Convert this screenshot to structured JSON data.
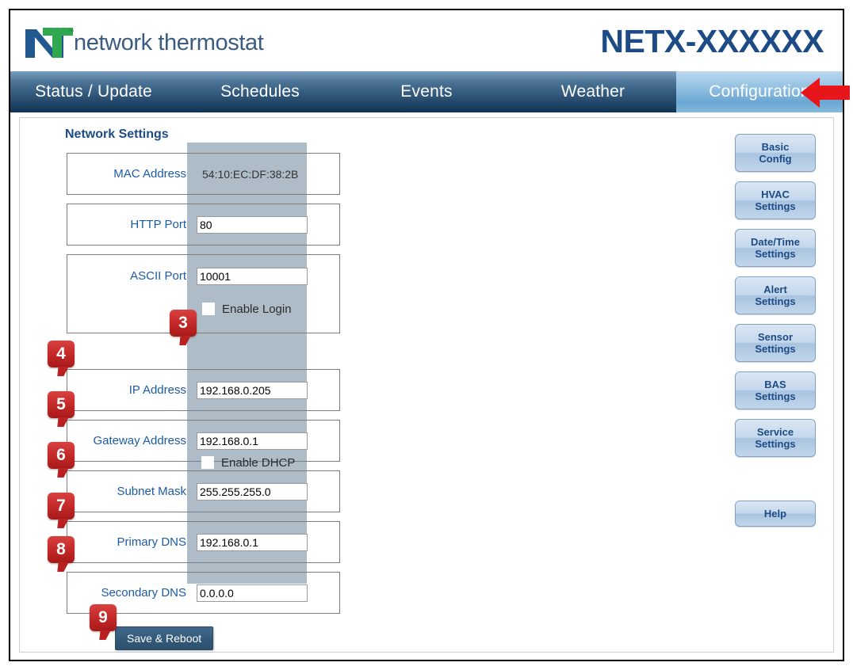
{
  "header": {
    "logo_text": "network thermostat",
    "logo_tm": "™",
    "logo_n": "N",
    "logo_t": "T",
    "device_title": "NETX-XXXXXX",
    "brand_blue": "#1c4b86",
    "brand_green": "#2fa84f"
  },
  "nav": {
    "tabs": [
      {
        "label": "Status / Update",
        "active": false
      },
      {
        "label": "Schedules",
        "active": false
      },
      {
        "label": "Events",
        "active": false
      },
      {
        "label": "Weather",
        "active": false
      },
      {
        "label": "Configuration",
        "active": true
      }
    ]
  },
  "main": {
    "section_title": "Network Settings",
    "rows": [
      {
        "label": "MAC Address",
        "value": "54:10:EC:DF:38:2B",
        "type": "static"
      },
      {
        "label": "HTTP Port",
        "value": "80",
        "type": "input"
      },
      {
        "label": "ASCII Port",
        "value": "10001",
        "type": "input",
        "checkbox_label": "Enable Login",
        "checked": false
      },
      {
        "label": "IP Address",
        "value": "192.168.0.205",
        "type": "input"
      },
      {
        "label": "Gateway Address",
        "value": "192.168.0.1",
        "type": "input"
      },
      {
        "label": "Subnet Mask",
        "value": "255.255.255.0",
        "type": "input"
      },
      {
        "label": "Primary DNS",
        "value": "192.168.0.1",
        "type": "input"
      },
      {
        "label": "Secondary DNS",
        "value": "0.0.0.0",
        "type": "input"
      }
    ],
    "dhcp": {
      "label": "Enable DHCP",
      "checked": false
    },
    "save_label": "Save & Reboot"
  },
  "sidebar": {
    "buttons": [
      {
        "line1": "Basic",
        "line2": "Config"
      },
      {
        "line1": "HVAC",
        "line2": "Settings"
      },
      {
        "line1": "Date/Time",
        "line2": "Settings"
      },
      {
        "line1": "Alert",
        "line2": "Settings"
      },
      {
        "line1": "Sensor",
        "line2": "Settings"
      },
      {
        "line1": "BAS",
        "line2": "Settings"
      },
      {
        "line1": "Service",
        "line2": "Settings"
      }
    ],
    "help_label": "Help"
  },
  "callouts": {
    "c3": "3",
    "c4": "4",
    "c5": "5",
    "c6": "6",
    "c7": "7",
    "c8": "8",
    "c9": "9"
  },
  "annotations": {
    "arrow_color": "#e8161a",
    "arrow_points_to": "Configuration"
  }
}
